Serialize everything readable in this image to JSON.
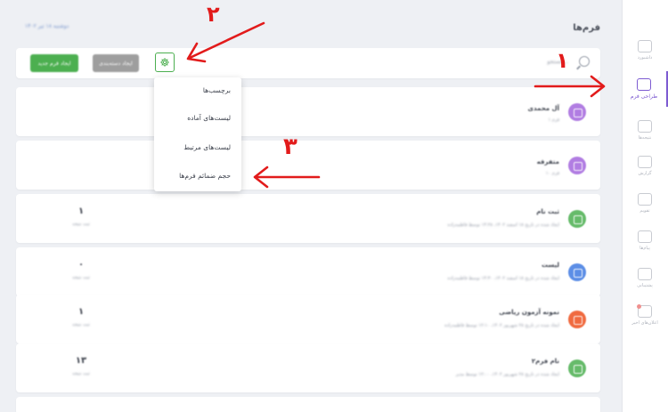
{
  "sidebar": {
    "items": [
      {
        "label": "داشبورد",
        "icon": "dashboard-icon"
      },
      {
        "label": "طراحی فرم",
        "icon": "form-design-icon",
        "active": true
      },
      {
        "label": "نتیجه‌ها",
        "icon": "results-icon"
      },
      {
        "label": "گزارش",
        "icon": "report-icon"
      },
      {
        "label": "تقویم",
        "icon": "calendar-icon"
      },
      {
        "label": "پیام‌ها",
        "icon": "messages-icon"
      },
      {
        "label": "پشتیبانی",
        "icon": "support-icon"
      },
      {
        "label": "اعلان‌های اخیر",
        "icon": "notifications-icon",
        "badge": true
      }
    ]
  },
  "header": {
    "title": "فرم‌ها",
    "date": "دوشنبه ۱۸ تیر ۱۴۰۲"
  },
  "toolbar": {
    "new_form_label": "ایجاد فرم جدید",
    "secondary_label": "ایجاد دسته‌بندی",
    "search_placeholder": "جستجو..."
  },
  "dropdown": {
    "items": [
      "برچسب‌ها",
      "لیست‌های آماده",
      "لیست‌های مرتبط",
      "حجم ضمائم فرم‌ها"
    ]
  },
  "forms": [
    {
      "title": "آل محمدی",
      "subtitle": "۱ فرم",
      "count": "",
      "count_label": "",
      "color": "#b17de2"
    },
    {
      "title": "متفرقه",
      "subtitle": "۱۰ فرم",
      "count": "",
      "count_label": "",
      "color": "#b17de2"
    },
    {
      "title": "ثبت نام",
      "subtitle": "ایجاد شده در تاریخ ۱۸ اسفند ۱۴۰۲، ۱۴:۲۸ توسط فاطمه‌زاده",
      "count": "۱",
      "count_label": "ثبت نتیجه",
      "color": "#66bb6a"
    },
    {
      "title": "لیست",
      "subtitle": "ایجاد شده در تاریخ ۱۸ اسفند ۱۴۰۲، ۱۴:۳۰ توسط فاطمه‌زاده",
      "count": "۰",
      "count_label": "ثبت نتیجه",
      "color": "#5c8ee6"
    },
    {
      "title": "نمونه آزمون ریاضی",
      "subtitle": "ایجاد شده در تاریخ ۲۸ شهریور ۱۴۰۲، ۱۲:۱۰ توسط فاطمه‌زاده",
      "count": "۱",
      "count_label": "ثبت نتیجه",
      "color": "#f06a3f"
    },
    {
      "title": "نام فرم۲",
      "subtitle": "ایجاد شده در تاریخ ۲۸ شهریور ۱۴۰۲، ۱۲:۰۰ توسط مدیر",
      "count": "۱۳",
      "count_label": "ثبت نتیجه",
      "color": "#66bb6a"
    }
  ],
  "annotations": {
    "one": "۱",
    "two": "۲",
    "three": "۳",
    "color": "#e21b1b"
  }
}
